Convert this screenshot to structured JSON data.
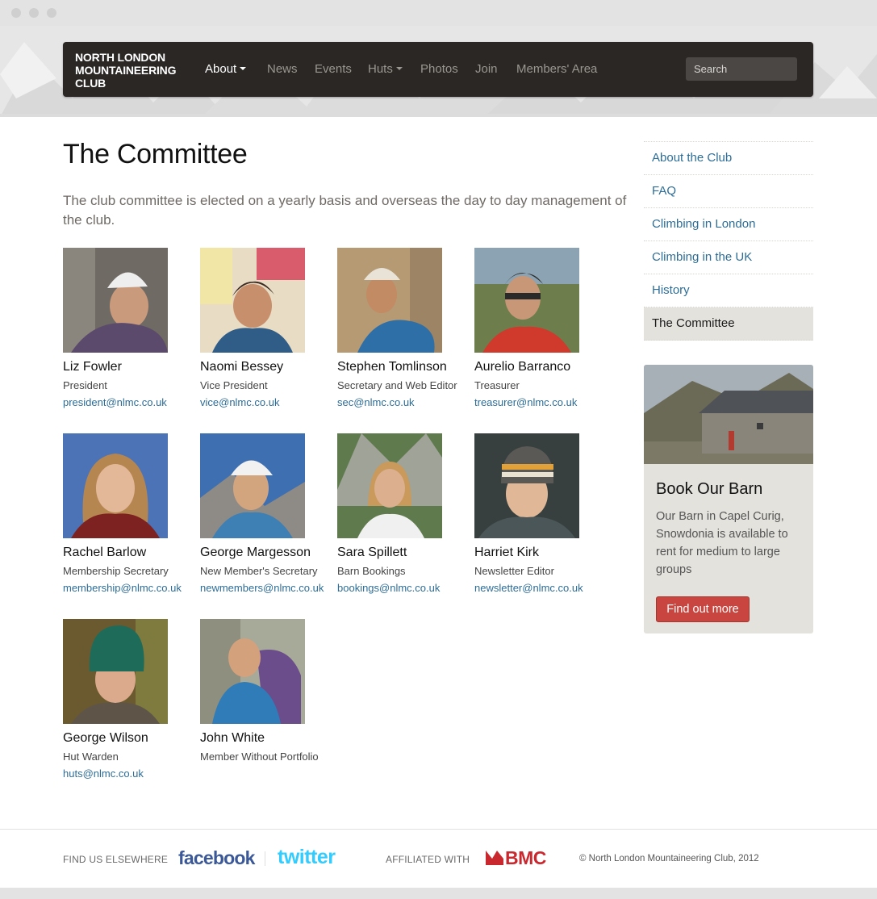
{
  "nav": {
    "brand": "NORTH LONDON MOUNTAINEERING CLUB",
    "items": [
      {
        "label": "About",
        "dropdown": true,
        "active": true
      },
      {
        "label": "News"
      },
      {
        "label": "Events"
      },
      {
        "label": "Huts",
        "dropdown": true
      },
      {
        "label": "Photos"
      },
      {
        "label": "Join"
      },
      {
        "label": "Members' Area"
      }
    ],
    "search_placeholder": "Search"
  },
  "main": {
    "title": "The Committee",
    "lead": "The club committee is elected on a yearly basis and overseas the day to day management of the club.",
    "members": [
      {
        "name": "Liz Fowler",
        "role": "President",
        "email": "president@nlmc.co.uk"
      },
      {
        "name": "Naomi Bessey",
        "role": "Vice President",
        "email": "vice@nlmc.co.uk"
      },
      {
        "name": "Stephen Tomlinson",
        "role": "Secretary and Web Editor",
        "email": "sec@nlmc.co.uk"
      },
      {
        "name": "Aurelio Barranco",
        "role": "Treasurer",
        "email": "treasurer@nlmc.co.uk"
      },
      {
        "name": "Rachel Barlow",
        "role": "Membership Secretary",
        "email": "membership@nlmc.co.uk"
      },
      {
        "name": "George Margesson",
        "role": "New Member's Secretary",
        "email": "newmembers@nlmc.co.uk"
      },
      {
        "name": "Sara Spillett",
        "role": "Barn Bookings",
        "email": "bookings@nlmc.co.uk"
      },
      {
        "name": "Harriet Kirk",
        "role": "Newsletter Editor",
        "email": "newsletter@nlmc.co.uk"
      },
      {
        "name": "George Wilson",
        "role": "Hut Warden",
        "email": "huts@nlmc.co.uk"
      },
      {
        "name": "John White",
        "role": "Member Without Portfolio",
        "email": ""
      }
    ]
  },
  "sidebar": {
    "items": [
      {
        "label": "About the Club"
      },
      {
        "label": "FAQ"
      },
      {
        "label": "Climbing in London"
      },
      {
        "label": "Climbing in the UK"
      },
      {
        "label": "History"
      },
      {
        "label": "The Committee",
        "active": true
      }
    ],
    "barn": {
      "title": "Book Our Barn",
      "text": "Our Barn in Capel Curig, Snowdonia is available to rent for medium to large groups",
      "button": "Find out more"
    }
  },
  "footer": {
    "find_us": "FIND US ELSEWHERE",
    "facebook": "facebook",
    "twitter": "twitter",
    "affiliated": "AFFILIATED WITH",
    "bmc": "BMC",
    "copyright": "© North London Mountaineering Club, 2012"
  },
  "colors": {
    "navbar": "#2a2725",
    "link": "#2d6d97",
    "button": "#c8463f",
    "sidebar_bg": "#e4e2dd"
  }
}
